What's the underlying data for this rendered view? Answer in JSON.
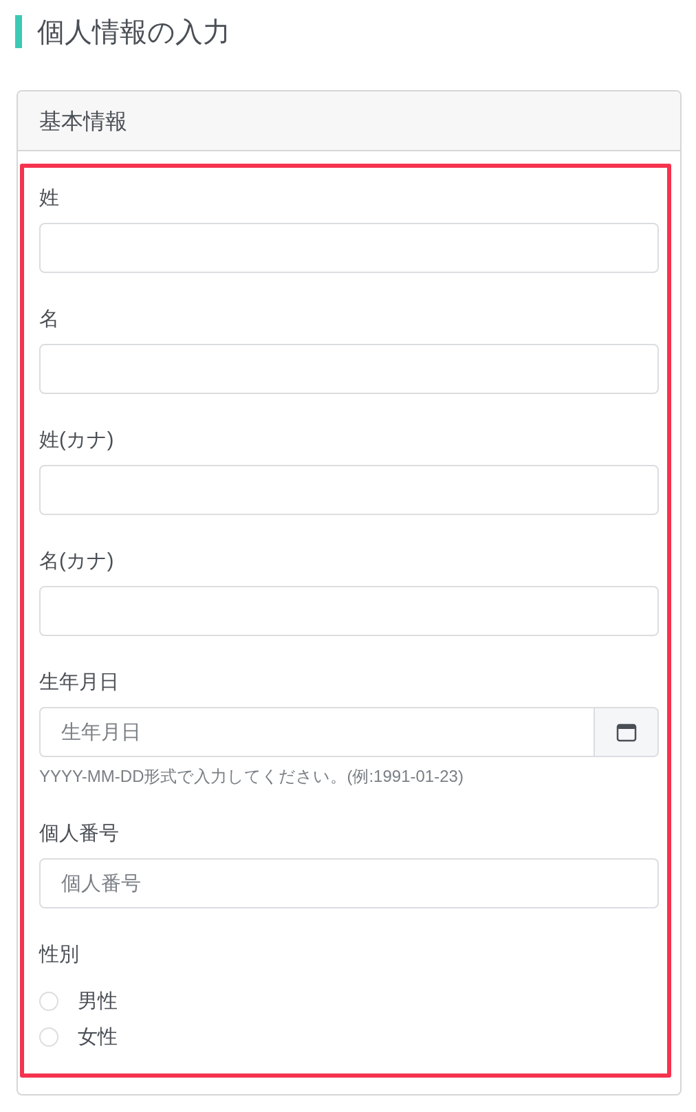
{
  "page_title": "個人情報の入力",
  "card": {
    "header": "基本情報",
    "fields": [
      {
        "kind": "text",
        "label": "姓"
      },
      {
        "kind": "text",
        "label": "名"
      },
      {
        "kind": "text",
        "label": "姓(カナ)"
      },
      {
        "kind": "text",
        "label": "名(カナ)"
      },
      {
        "kind": "date",
        "label": "生年月日",
        "placeholder": "生年月日",
        "help": "YYYY-MM-DD形式で入力してください。(例:1991-01-23)"
      },
      {
        "kind": "text",
        "label": "個人番号",
        "placeholder": "個人番号"
      },
      {
        "kind": "radio",
        "label": "性別",
        "options": [
          {
            "label": "男性",
            "selected": false
          },
          {
            "label": "女性",
            "selected": false
          }
        ]
      }
    ]
  }
}
